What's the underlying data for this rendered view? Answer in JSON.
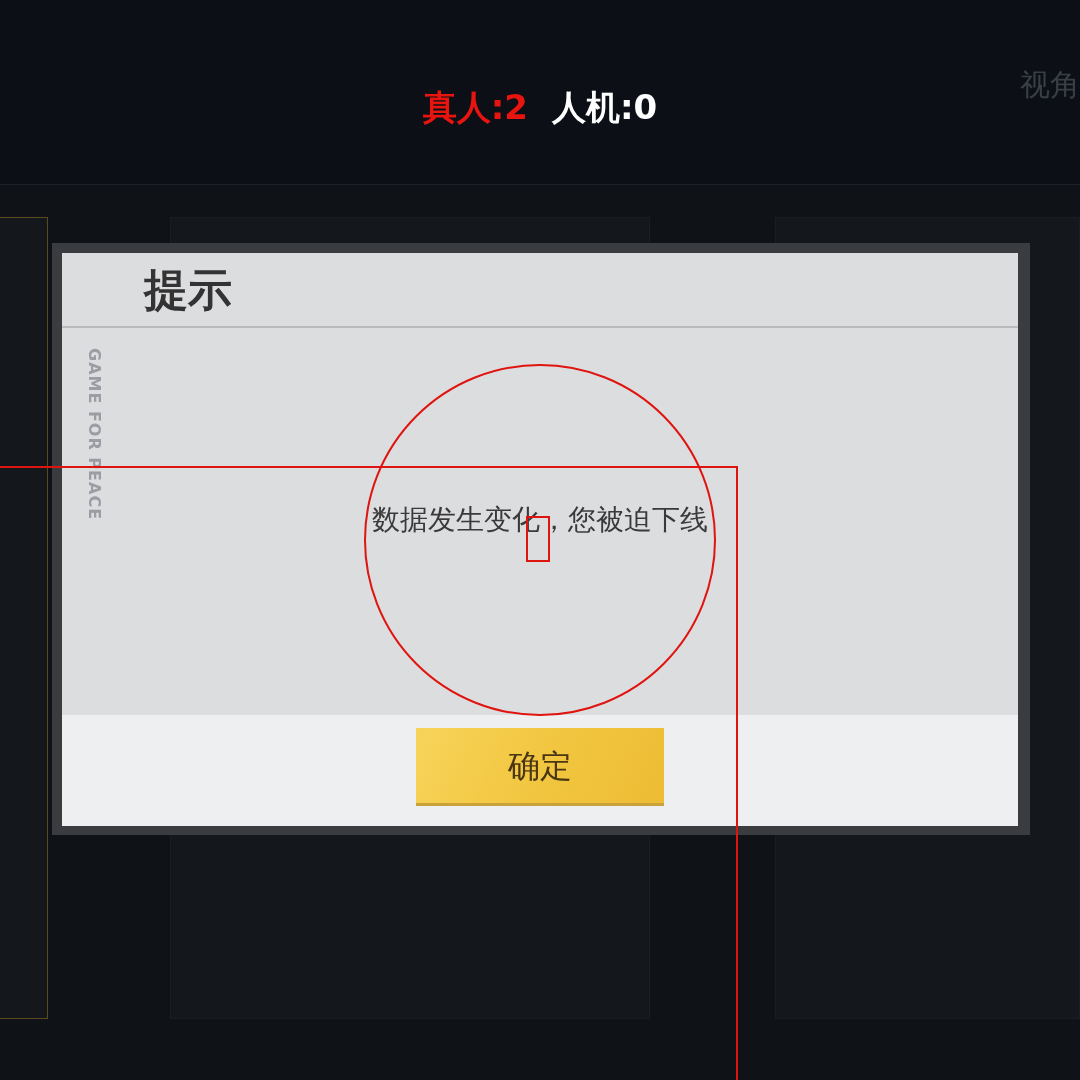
{
  "header": {
    "counts": [
      {
        "label": "真人:2",
        "highlight": true
      },
      {
        "label": "人机:0",
        "highlight": false
      }
    ],
    "corner_text": "视角"
  },
  "dialog": {
    "title": "提示",
    "side_text": "GAME FOR PEACE",
    "message": "数据发生变化，您被迫下线",
    "buttons": [
      "确定"
    ]
  },
  "annotations": [
    {
      "kind": "circle"
    },
    {
      "kind": "frame"
    },
    {
      "kind": "marker"
    }
  ]
}
